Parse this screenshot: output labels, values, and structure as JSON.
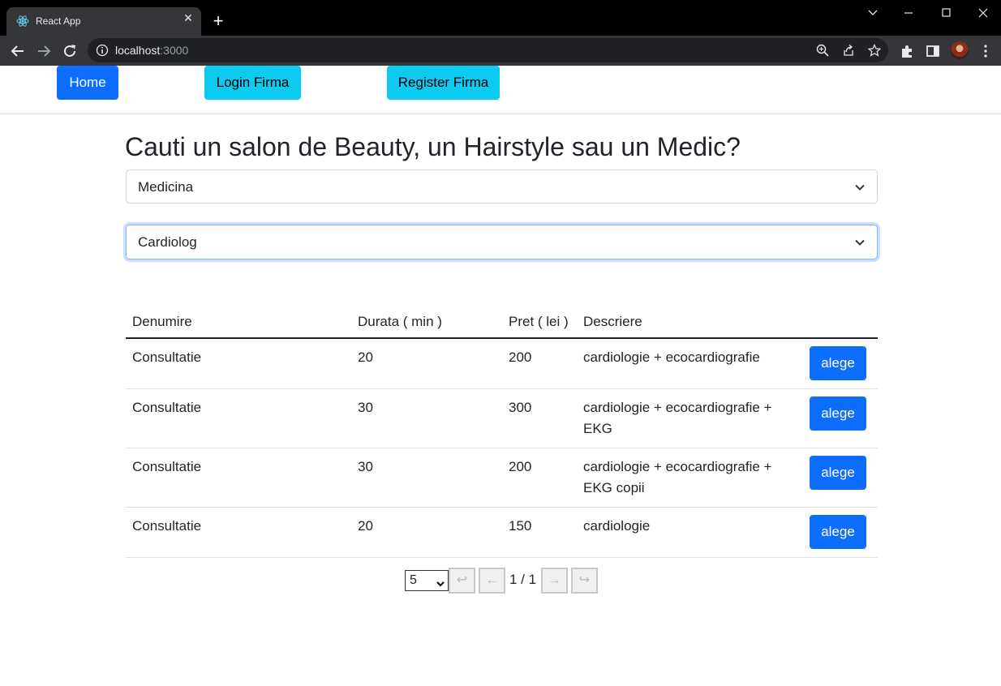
{
  "browser": {
    "tab_title": "React App",
    "url_host": "localhost",
    "url_port": ":3000"
  },
  "nav": {
    "home": "Home",
    "login": "Login Firma",
    "register": "Register Firma"
  },
  "headline": "Cauti un salon de Beauty, un Hairstyle sau un Medic?",
  "filters": {
    "category": "Medicina",
    "specialty": "Cardiolog"
  },
  "table": {
    "headers": [
      "Denumire",
      "Durata ( min )",
      "Pret ( lei )",
      "Descriere"
    ],
    "rows": [
      {
        "name": "Consultatie",
        "duration": "20",
        "price": "200",
        "description": "cardiologie + ecocardiografie",
        "action": "alege"
      },
      {
        "name": "Consultatie",
        "duration": "30",
        "price": "300",
        "description": "cardiologie + ecocardiografie + EKG",
        "action": "alege"
      },
      {
        "name": "Consultatie",
        "duration": "30",
        "price": "200",
        "description": "cardiologie + ecocardiografie + EKG copii",
        "action": "alege"
      },
      {
        "name": "Consultatie",
        "duration": "20",
        "price": "150",
        "description": "cardiologie",
        "action": "alege"
      }
    ]
  },
  "pagination": {
    "page_size": "5",
    "first": "↩",
    "prev": "←",
    "info": "1 / 1",
    "next": "→",
    "last": "↪"
  },
  "colors": {
    "primary": "#0d6efd",
    "info": "#0dcaf0"
  }
}
